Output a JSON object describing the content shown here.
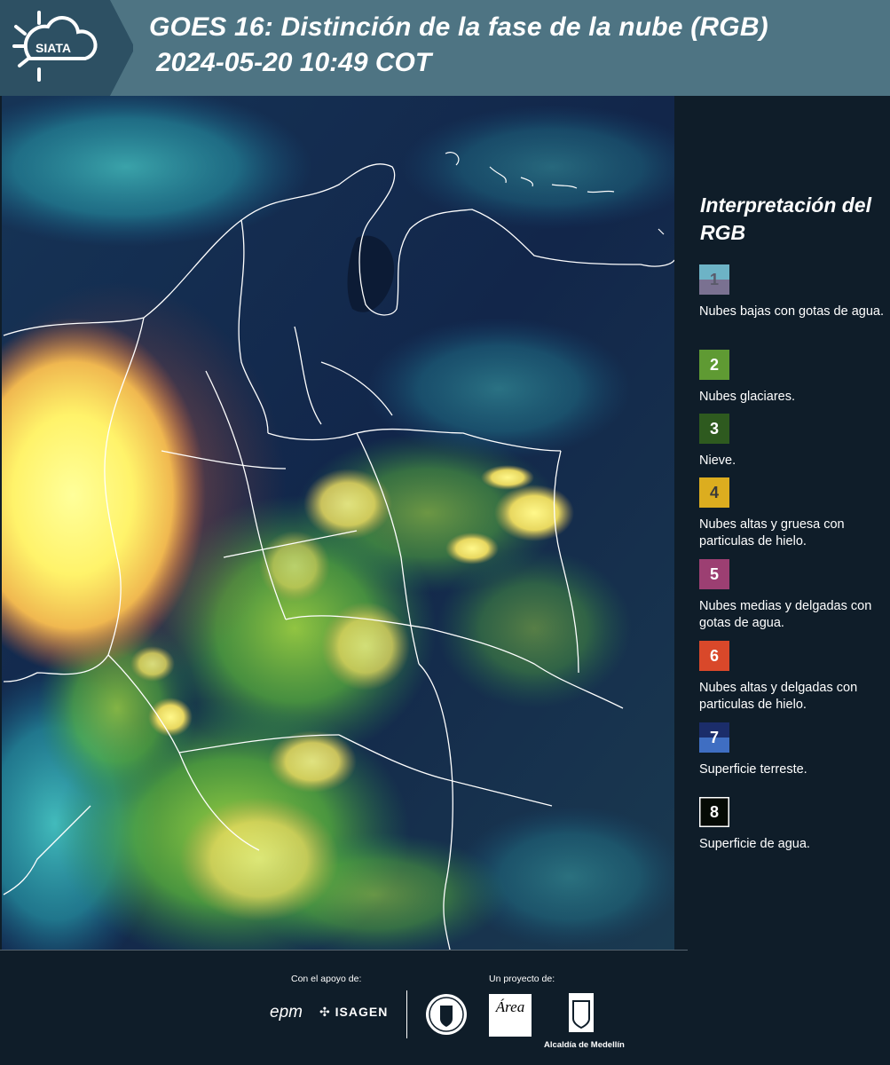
{
  "header": {
    "brand": "SIATA",
    "title_line1": "GOES 16: Distinción de la fase de la nube (RGB)",
    "title_line2": "2024-05-20 10:49 COT"
  },
  "legend": {
    "title": "Interpretación del RGB",
    "items": [
      {
        "number": "1",
        "label": "Nubes bajas con gotas de agua.",
        "color_top": "#6db3c6",
        "color_bottom": "#7a7191",
        "number_color": "#5a5a6a"
      },
      {
        "number": "2",
        "label": "Nubes glaciares.",
        "color_top": "#5f9a33",
        "color_bottom": "#5f9a33",
        "number_color": "#ffffff"
      },
      {
        "number": "3",
        "label": "Nieve.",
        "color_top": "#2e5a1f",
        "color_bottom": "#2e5a1f",
        "number_color": "#ffffff"
      },
      {
        "number": "4",
        "label": "Nubes altas y gruesa con particulas de hielo.",
        "color_top": "#dcad1f",
        "color_bottom": "#dcad1f",
        "number_color": "#3a3a3a"
      },
      {
        "number": "5",
        "label": "Nubes medias y delgadas con gotas de agua.",
        "color_top": "#9c3f72",
        "color_bottom": "#9c3f72",
        "number_color": "#ffffff"
      },
      {
        "number": "6",
        "label": "Nubes altas y delgadas con particulas de hielo.",
        "color_top": "#d9482a",
        "color_bottom": "#d9482a",
        "number_color": "#ffffff"
      },
      {
        "number": "7",
        "label": "Superficie terreste.",
        "color_top": "#1b2d6a",
        "color_bottom": "#3f6ec2",
        "number_color": "#ffffff"
      },
      {
        "number": "8",
        "label": "Superficie de agua.",
        "color_top": "#050a05",
        "color_bottom": "#050a05",
        "number_color": "#ffffff",
        "border": "#ffffff"
      }
    ]
  },
  "footer": {
    "support_label": "Con el apoyo de:",
    "project_label": "Un proyecto de:",
    "epm": "epm",
    "isagen": "ISAGEN",
    "area": "Área",
    "alcaldia": "Alcaldía de Medellín"
  }
}
